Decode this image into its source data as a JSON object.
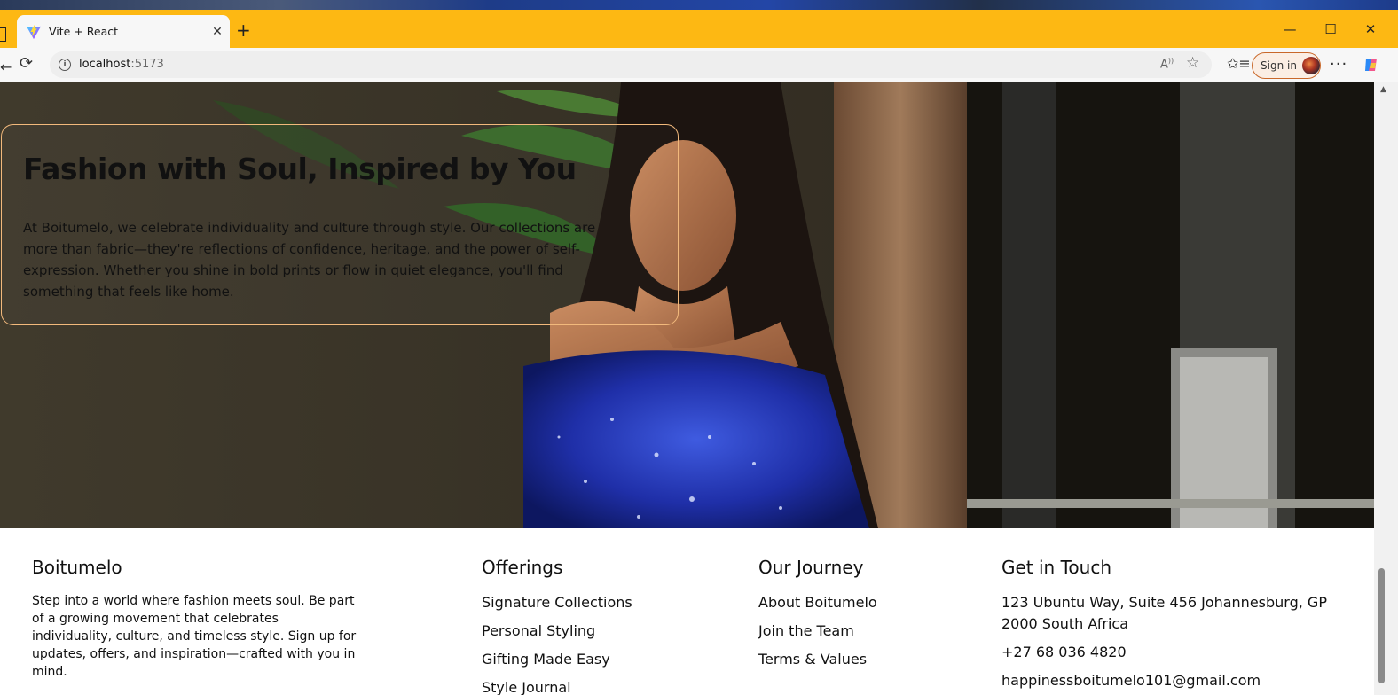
{
  "browser": {
    "tab_title": "Vite + React",
    "url_host": "localhost",
    "url_port": ":5173",
    "signin_label": "Sign in",
    "accent_color": "#fdb813"
  },
  "hero": {
    "title": "Fashion with Soul, Inspired by You",
    "text": "At Boitumelo, we celebrate individuality and culture through style. Our collections are more than fabric—they're reflections of confidence, heritage, and the power of self-expression. Whether you shine in bold prints or flow in quiet elegance, you'll find something that feels like home."
  },
  "footer": {
    "brand": {
      "title": "Boitumelo",
      "blurb": "Step into a world where fashion meets soul. Be part of a growing movement that celebrates individuality, culture, and timeless style. Sign up for updates, offers, and inspiration—crafted with you in mind."
    },
    "offerings": {
      "title": "Offerings",
      "items": [
        "Signature Collections",
        "Personal Styling",
        "Gifting Made Easy",
        "Style Journal"
      ]
    },
    "journey": {
      "title": "Our Journey",
      "items": [
        "About Boitumelo",
        "Join the Team",
        "Terms & Values"
      ]
    },
    "contact": {
      "title": "Get in Touch",
      "address": "123 Ubuntu Way, Suite 456 Johannesburg, GP 2000 South Africa",
      "phone": "+27 68 036 4820",
      "email": "happinessboitumelo101@gmail.com"
    }
  },
  "icons": [
    "vite-favicon-icon",
    "close-icon",
    "plus-icon",
    "minimize-icon",
    "maximize-icon",
    "refresh-icon",
    "info-icon",
    "read-aloud-icon",
    "star-icon",
    "favorites-icon",
    "more-icon",
    "copilot-icon"
  ]
}
